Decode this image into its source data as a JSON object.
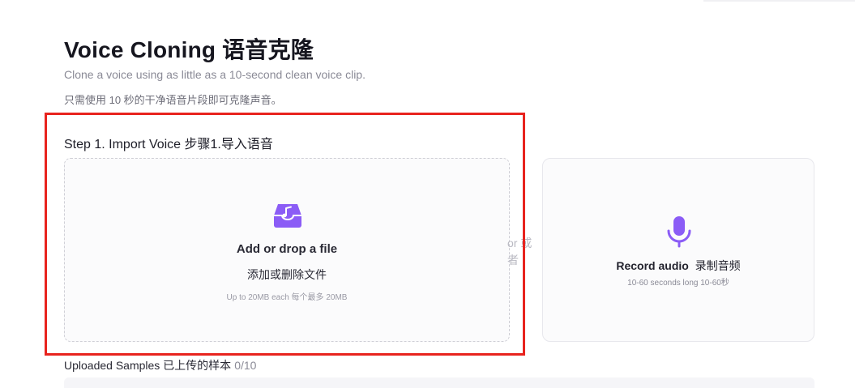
{
  "header": {
    "title": "Voice Cloning  语音克隆",
    "subtitle_en": "Clone a voice using as little as a 10-second clean voice clip.",
    "subtitle_zh": "只需使用 10 秒的干净语音片段即可克隆声音。"
  },
  "step1": {
    "title": "Step 1. Import Voice  步骤1.导入语音",
    "upload": {
      "icon": "music-inbox-icon",
      "title": "Add or drop a file",
      "title_zh": "添加或删除文件",
      "limit": "Up to 20MB each  每个最多 20MB"
    },
    "or_text": "or 或者",
    "record": {
      "icon": "microphone-icon",
      "title_en": "Record audio",
      "title_zh": "录制音频",
      "subtitle": "10-60 seconds long  10-60秒"
    }
  },
  "samples": {
    "label": "Uploaded Samples  已上传的样本",
    "count": "0/10"
  },
  "colors": {
    "accent": "#8b5cf6",
    "highlight": "#e8231e"
  }
}
